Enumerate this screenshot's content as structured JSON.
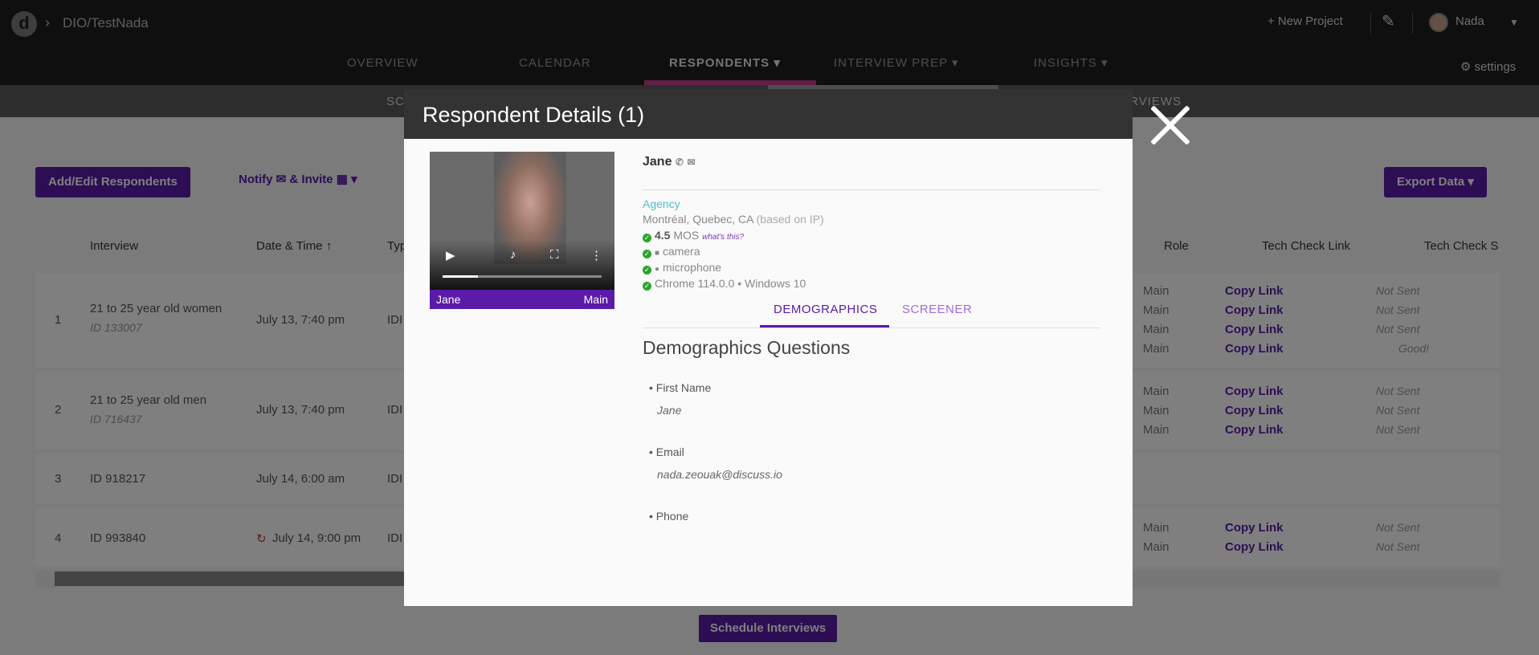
{
  "topbar": {
    "breadcrumb": "DIO/TestNada",
    "new_project": "+ New Project",
    "user": "Nada",
    "settings": "⚙ settings"
  },
  "nav": {
    "overview": "OVERVIEW",
    "calendar": "CALENDAR",
    "respondents": "RESPONDENTS ▾",
    "interview_prep": "INTERVIEW PREP ▾",
    "insights": "INSIGHTS ▾"
  },
  "subnav": {
    "left": "SC",
    "right": "TERVIEWS"
  },
  "toolbar": {
    "add_edit": "Add/Edit Respondents",
    "notify": "Notify ✉ & Invite ▦ ▾",
    "export": "Export Data  ▾"
  },
  "table": {
    "headers": {
      "interview": "Interview",
      "datetime": "Date & Time ↑",
      "type": "Typ",
      "role": "Role",
      "tech_check_link": "Tech Check Link",
      "tech_check_status": "Tech Check S"
    },
    "rows": [
      {
        "num": "1",
        "title": "21 to 25 year old women",
        "id": "ID 133007",
        "date": "July 13, 7:40 pm",
        "type": "IDI"
      },
      {
        "num": "2",
        "title": "21 to 25 year old men",
        "id": "ID 716437",
        "date": "July 13, 7:40 pm",
        "type": "IDI"
      },
      {
        "num": "3",
        "title": "ID 918217",
        "id": "",
        "date": "July 14, 6:00 am",
        "type": "IDI"
      },
      {
        "num": "4",
        "title": "ID 993840",
        "id": "",
        "date": "July 14, 9:00 pm",
        "type": "IDI"
      }
    ],
    "main": "Main",
    "copy_link": "Copy Link",
    "not_sent": "Not Sent",
    "good": "Good!"
  },
  "schedule_button": "Schedule Interviews",
  "modal": {
    "title": "Respondent Details (1)",
    "video": {
      "name": "Jane",
      "role": "Main"
    },
    "respondent": {
      "name": "Jane",
      "agency": "Agency",
      "location": "Montréal, Quebec, CA",
      "location_note": "(based on IP)",
      "mos": "4.5",
      "mos_label": "MOS",
      "whats_this": "what's this?",
      "camera": "camera",
      "microphone": "microphone",
      "browser": "Chrome 114.0.0 • Windows 10"
    },
    "tabs": {
      "demographics": "DEMOGRAPHICS",
      "screener": "SCREENER"
    },
    "section_title": "Demographics Questions",
    "questions": [
      {
        "q": "First Name",
        "a": "Jane"
      },
      {
        "q": "Email",
        "a": "nada.zeouak@discuss.io"
      },
      {
        "q": "Phone",
        "a": ""
      }
    ]
  },
  "colors": {
    "accent": "#5b1aa8",
    "topbar": "#1e1e1e",
    "modal_header": "#333333",
    "agency": "#4fbfc4",
    "check": "#2aa52a"
  }
}
